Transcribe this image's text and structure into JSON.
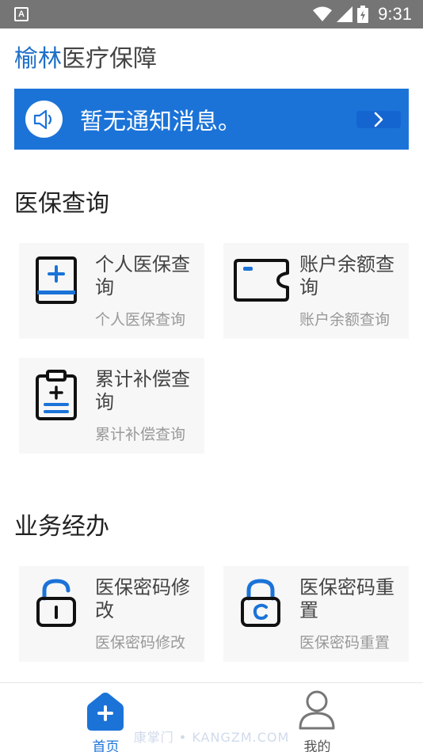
{
  "status_bar": {
    "notif_glyph": "A",
    "time": "9:31"
  },
  "header": {
    "title_brand": "榆林",
    "title_rest": "医疗保障"
  },
  "notice": {
    "text": "暂无通知消息。"
  },
  "sections": {
    "query_title": "医保查询",
    "business_title": "业务经办"
  },
  "cards": [
    {
      "title": "个人医保查询",
      "subtitle": "个人医保查询"
    },
    {
      "title": "账户余额查询",
      "subtitle": "账户余额查询"
    },
    {
      "title": "累计补偿查询",
      "subtitle": "累计补偿查询"
    },
    {
      "title": "医保密码修改",
      "subtitle": "医保密码修改"
    },
    {
      "title": "医保密码重置",
      "subtitle": "医保密码重置"
    }
  ],
  "bottom_nav": {
    "home_label": "首页",
    "mine_label": "我的"
  },
  "watermark": "康掌门 • KANGZM.COM",
  "colors": {
    "primary": "#1b73d8",
    "brand_text": "#1f6fc7",
    "status_bar": "#757575",
    "card_bg": "#f7f7f7"
  }
}
